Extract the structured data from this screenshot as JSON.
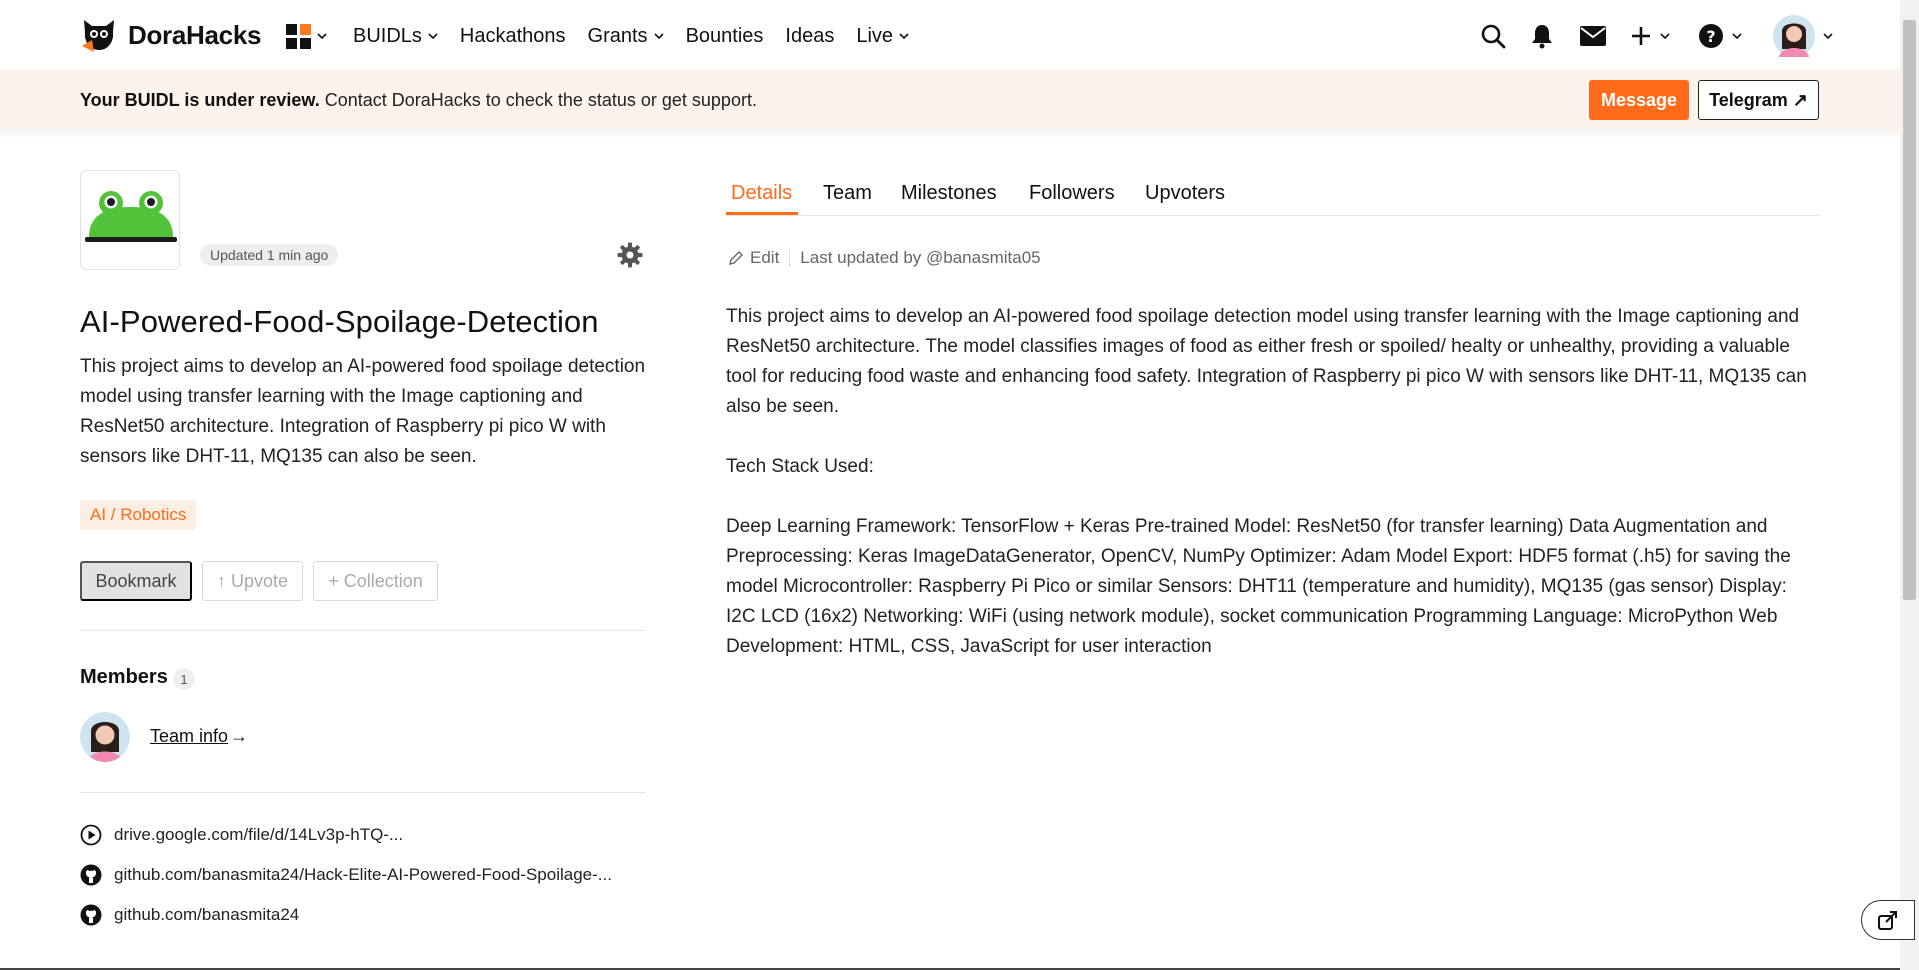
{
  "brand": {
    "name": "DoraHacks"
  },
  "nav": {
    "items": [
      {
        "label": "BUIDLs",
        "dropdown": true
      },
      {
        "label": "Hackathons",
        "dropdown": false
      },
      {
        "label": "Grants",
        "dropdown": true
      },
      {
        "label": "Bounties",
        "dropdown": false
      },
      {
        "label": "Ideas",
        "dropdown": false
      },
      {
        "label": "Live",
        "dropdown": true
      }
    ],
    "right_icons": [
      "search-icon",
      "bell-icon",
      "mail-icon",
      "plus-icon",
      "help-icon",
      "avatar"
    ]
  },
  "banner": {
    "bold": "Your BUIDL is under review.",
    "text": " Contact DoraHacks to check the status or get support.",
    "message_label": "Message",
    "telegram_label": "Telegram ↗"
  },
  "project": {
    "updated": "Updated 1 min ago",
    "title": "AI-Powered-Food-Spoilage-Detection",
    "description": "This project aims to develop an AI-powered food spoilage detection model using transfer learning with the Image captioning and ResNet50 architecture. Integration of Raspberry pi pico W with sensors like DHT-11, MQ135 can also be seen.",
    "tag": "AI / Robotics",
    "bookmark_label": "Bookmark",
    "upvote_label": "↑ Upvote",
    "collection_label": "+ Collection"
  },
  "members": {
    "label": "Members",
    "count": "1",
    "team_info": "Team info",
    "arrow": "→"
  },
  "links": [
    {
      "icon": "play-circle-icon",
      "text": "drive.google.com/file/d/14Lv3p-hTQ-..."
    },
    {
      "icon": "github-icon",
      "text": "github.com/banasmita24/Hack-Elite-AI-Powered-Food-Spoilage-..."
    },
    {
      "icon": "github-icon",
      "text": "github.com/banasmita24"
    }
  ],
  "tabs": [
    {
      "label": "Details",
      "active": true
    },
    {
      "label": "Team",
      "active": false
    },
    {
      "label": "Milestones",
      "active": false
    },
    {
      "label": "Followers",
      "active": false
    },
    {
      "label": "Upvoters",
      "active": false
    }
  ],
  "details": {
    "edit_label": "Edit",
    "last_updated": "Last updated by @banasmita05",
    "paragraph1": "This project aims to develop an AI-powered food spoilage detection model using transfer learning with the Image captioning and ResNet50 architecture. The model classifies images of food as either fresh or spoiled/ healty or unhealthy, providing a valuable tool for reducing food waste and enhancing food safety. Integration of Raspberry pi pico W with sensors like DHT-11, MQ135 can also be seen.",
    "tech_heading": "Tech Stack Used:",
    "tech_stack": "Deep Learning Framework: TensorFlow + Keras Pre-trained Model: ResNet50 (for transfer learning) Data Augmentation and Preprocessing: Keras ImageDataGenerator, OpenCV, NumPy Optimizer: Adam Model Export: HDF5 format (.h5) for saving the model Microcontroller: Raspberry Pi Pico or similar Sensors: DHT11 (temperature and humidity), MQ135 (gas sensor) Display: I2C LCD (16x2) Networking: WiFi (using network module), socket communication Programming Language: MicroPython Web Development: HTML, CSS, JavaScript for user interaction"
  },
  "colors": {
    "accent": "#ff6b1a",
    "banner_bg": "#fdf3ed",
    "tag_bg": "#fdeee4"
  }
}
